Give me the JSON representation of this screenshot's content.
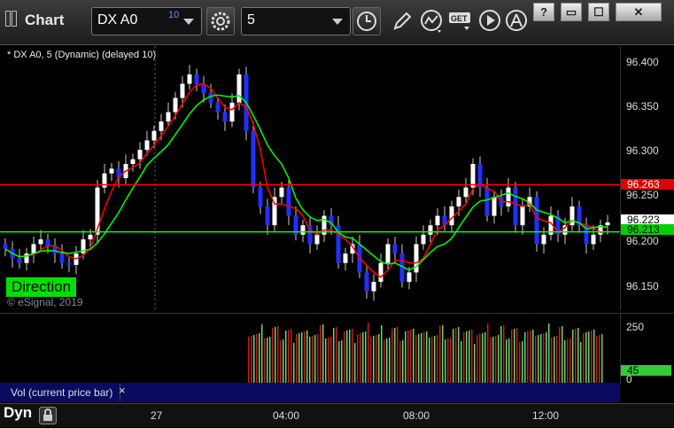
{
  "window": {
    "title": "Chart",
    "symbol": "DX A0",
    "symbol_superscript": "10",
    "interval": "5",
    "icons": [
      "settings-icon",
      "clock-icon",
      "pencil-icon",
      "study-icon",
      "get-icon",
      "play-icon",
      "alert-icon"
    ],
    "window_buttons": [
      "?",
      "▭",
      "☐",
      "✕"
    ]
  },
  "chart": {
    "caption": "* DX A0, 5 (Dynamic) (delayed 10)",
    "direction_label": "Direction",
    "copyright": "© eSignal, 2019",
    "price_ticks": [
      "96.400",
      "96.350",
      "96.300",
      "96.250",
      "96.200",
      "96.150"
    ],
    "price_tags": [
      {
        "text": "96.263",
        "bg": "#e00000",
        "fg": "#ffffff"
      },
      {
        "text": "96.223",
        "bg": "#ffffff",
        "fg": "#000000"
      },
      {
        "text": "96.213",
        "bg": "#00d000",
        "fg": "#000000"
      }
    ],
    "colors": {
      "up": "#ffffff",
      "down": "#2030ff",
      "ma_fast": "#ff0000",
      "ma_mid": "#00ff00",
      "level_red": "#ff0000",
      "level_green": "#00ff00"
    }
  },
  "volume": {
    "label": "Vol (current price bar)",
    "close_symbol": "×",
    "ticks": [
      "250",
      "0"
    ],
    "current_tag": "45",
    "colors": {
      "up": "#70d070",
      "down": "#c02020"
    }
  },
  "time_axis": {
    "dyn_label": "Dyn",
    "labels": [
      "27",
      "04:00",
      "08:00",
      "12:00"
    ]
  },
  "chart_data": {
    "type": "candlestick",
    "ylim": [
      96.13,
      96.41
    ],
    "levels": [
      {
        "name": "",
        "value": 96.263,
        "color": "#ff0000"
      },
      {
        "name": "",
        "value": 96.213,
        "color": "#00ff00"
      }
    ],
    "closes": [
      96.195,
      96.185,
      96.18,
      96.19,
      96.2,
      96.205,
      96.198,
      96.19,
      96.18,
      96.178,
      96.19,
      96.205,
      96.21,
      96.26,
      96.275,
      96.28,
      96.27,
      96.285,
      96.29,
      96.3,
      96.31,
      96.32,
      96.33,
      96.34,
      96.355,
      96.37,
      96.38,
      96.37,
      96.36,
      96.35,
      96.34,
      96.33,
      96.35,
      96.38,
      96.32,
      96.26,
      96.24,
      96.22,
      96.25,
      96.26,
      96.23,
      96.21,
      96.22,
      96.2,
      96.21,
      96.23,
      96.22,
      96.18,
      96.19,
      96.2,
      96.17,
      96.15,
      96.16,
      96.18,
      96.2,
      96.19,
      96.16,
      96.17,
      96.2,
      96.21,
      96.22,
      96.23,
      96.22,
      96.24,
      96.25,
      96.26,
      96.285,
      96.26,
      96.23,
      96.25,
      96.24,
      96.26,
      96.22,
      96.24,
      96.25,
      96.2,
      96.21,
      96.23,
      96.21,
      96.22,
      96.24,
      96.22,
      96.2,
      96.21,
      96.22,
      96.223
    ],
    "volume_max": 250,
    "volume_current": 45
  }
}
